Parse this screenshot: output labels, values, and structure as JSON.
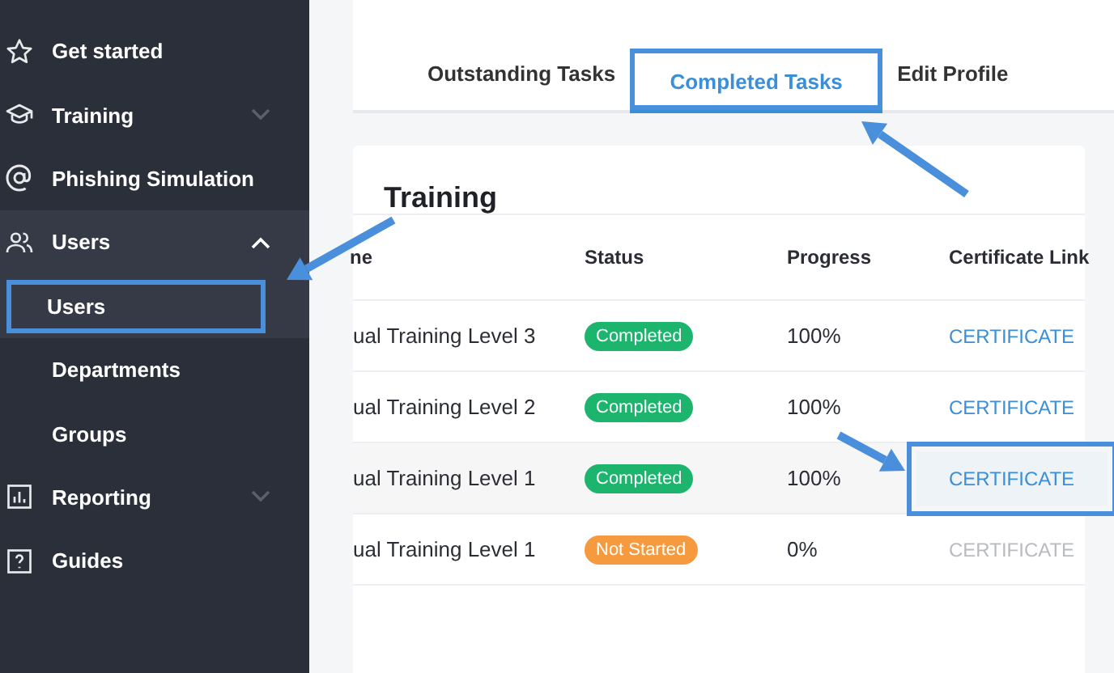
{
  "sidebar": {
    "items": [
      {
        "label": "Get started"
      },
      {
        "label": "Training",
        "expanded": false
      },
      {
        "label": "Phishing Simulation"
      },
      {
        "label": "Users",
        "expanded": true,
        "children": [
          {
            "label": "Users",
            "highlighted": true
          },
          {
            "label": "Departments",
            "highlighted": false
          },
          {
            "label": "Groups",
            "highlighted": false
          }
        ]
      },
      {
        "label": "Reporting",
        "expanded": false
      },
      {
        "label": "Guides"
      }
    ]
  },
  "tabs": [
    {
      "label": "Outstanding Tasks",
      "selected": false,
      "highlighted": false
    },
    {
      "label": "Completed Tasks",
      "selected": true,
      "highlighted": true
    },
    {
      "label": "Edit Profile",
      "selected": false,
      "highlighted": false
    }
  ],
  "training": {
    "title": "Training",
    "columns": [
      "ne",
      "Status",
      "Progress",
      "Certificate Link"
    ],
    "rows": [
      {
        "name": "ual Training Level 3",
        "status": {
          "label": "Completed",
          "kind": "completed"
        },
        "progress": "100%",
        "certificate": {
          "label": "CERTIFICATE",
          "disabled": false,
          "highlighted": false
        },
        "hovered": false
      },
      {
        "name": "ual Training Level 2",
        "status": {
          "label": "Completed",
          "kind": "completed"
        },
        "progress": "100%",
        "certificate": {
          "label": "CERTIFICATE",
          "disabled": false,
          "highlighted": false
        },
        "hovered": false
      },
      {
        "name": "ual Training Level 1",
        "status": {
          "label": "Completed",
          "kind": "completed"
        },
        "progress": "100%",
        "certificate": {
          "label": "CERTIFICATE",
          "disabled": false,
          "highlighted": true
        },
        "hovered": true
      },
      {
        "name": "ual Training Level 1",
        "status": {
          "label": "Not Started",
          "kind": "not_started"
        },
        "progress": "0%",
        "certificate": {
          "label": "CERTIFICATE",
          "disabled": true,
          "highlighted": false
        },
        "hovered": false
      }
    ]
  }
}
